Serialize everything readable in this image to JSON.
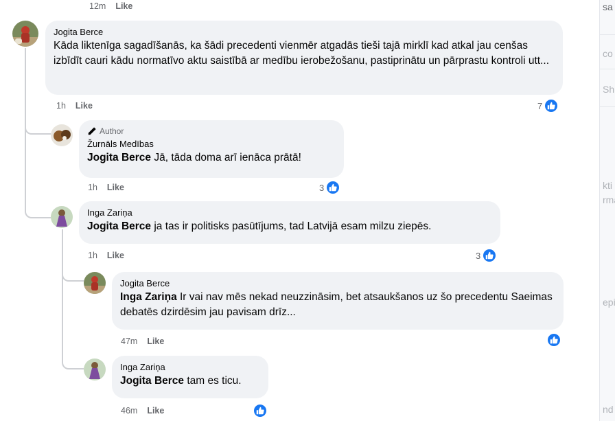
{
  "top_meta": {
    "time": "12m",
    "like": "Like"
  },
  "comments": [
    {
      "author": "Jogita Berce",
      "text": "Kāda liktenīga sagadīšanās, ka šādi precedenti vienmēr atgadās tieši tajā mirklī kad atkal jau cenšas izbīdīt cauri kādu normatīvo aktu saistībā ar medību ierobežošanu, pastiprinātu un pārprastu kontroli utt...",
      "time": "1h",
      "like": "Like",
      "reactions": "7"
    },
    {
      "badge": "Author",
      "author": "Žurnāls Medības",
      "mention": "Jogita Berce",
      "text": " Jā, tāda doma arī ienāca prātā!",
      "time": "1h",
      "like": "Like",
      "reactions": "3"
    },
    {
      "author": "Inga Zariņa",
      "mention": "Jogita Berce",
      "text": " ja tas ir politisks pasūtījums, tad Latvijā esam milzu ziepēs.",
      "time": "1h",
      "like": "Like",
      "reactions": "3"
    },
    {
      "author": "Jogita Berce",
      "mention": "Inga Zariņa",
      "text": " Ir vai nav mēs nekad neuzzināsim, bet atsaukšanos uz šo precedentu Saeimas debatēs dzirdēsim jau pavisam drīz...",
      "time": "47m",
      "like": "Like"
    },
    {
      "author": "Inga Zariņa",
      "mention": "Jogita Berce",
      "text": " tam es ticu.",
      "time": "46m",
      "like": "Like"
    }
  ],
  "right_panel_fragments": [
    "sa",
    "co",
    "Sh",
    "kti p",
    "rma",
    "epie",
    "nd"
  ],
  "colors": {
    "accent": "#1877f2",
    "bubble": "#f0f2f5",
    "meta": "#65676b",
    "line": "#ced0d4"
  }
}
